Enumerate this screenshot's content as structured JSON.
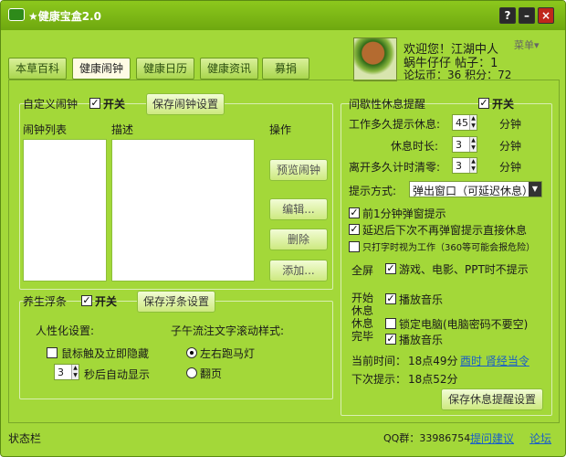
{
  "window": {
    "title": "★健康宝盒2.0",
    "buttons": {
      "help": "?",
      "minimize": "–",
      "close": "×"
    }
  },
  "user": {
    "welcome": "欢迎您！江湖中人",
    "name_line": "蜗牛仔仔  帖子：1",
    "forum_line": "论坛币：36 积分：72",
    "menu": "菜单▾"
  },
  "tabs": [
    "本草百科",
    "健康闹钟",
    "健康日历",
    "健康资讯",
    "募捐"
  ],
  "custom_alarm": {
    "title": "自定义闹钟",
    "toggle": "开关",
    "save": "保存闹钟设置",
    "list_label": "闹钟列表",
    "description_label": "描述",
    "operation_label": "操作",
    "preview": "预览闹钟",
    "edit": "编辑...",
    "delete": "删除",
    "add": "添加..."
  },
  "float_bar": {
    "title": "养生浮条",
    "toggle": "开关",
    "save": "保存浮条设置",
    "personal": "人性化设置:",
    "hide_on_touch": "鼠标触及立即隐藏",
    "auto_show_value": "3",
    "auto_show_suffix": "秒后自动显示",
    "style_title": "子午流注文字滚动样式:",
    "marquee": "左右跑马灯",
    "flip": "翻页"
  },
  "break_reminder": {
    "title": "间歇性休息提醒",
    "toggle": "开关",
    "work_label": "工作多久提示休息:",
    "work_value": "45",
    "minute_unit": "分钟",
    "rest_label": "休息时长:",
    "rest_value": "3",
    "away_label": "离开多久计时清零:",
    "away_value": "3",
    "method_label": "提示方式:",
    "method_value": "弹出窗口（可延迟休息）",
    "pre_popup": "前1分钟弹窗提示",
    "delay_popup": "延迟后下次不再弹窗提示直接休息",
    "typing_work": "只打字时视为工作（360等可能会报危险）",
    "fullscreen": "全屏",
    "fullscreen_text": "游戏、电影、PPT时不提示",
    "start_label": "开始休息",
    "play_music": "播放音乐",
    "finish_label": "休息完毕",
    "lock_pc": "锁定电脑(电脑密码不要空)",
    "play_music2": "播放音乐",
    "current_time_label": "当前时间：",
    "current_time_value": "18点49分",
    "current_link": "酉时 肾经当令",
    "next_label": "下次提示：",
    "next_value": "18点52分",
    "save": "保存休息提醒设置"
  },
  "status": {
    "left": "状态栏",
    "qq": "QQ群：33986754",
    "suggest": "提问建议",
    "forum": "论坛"
  }
}
